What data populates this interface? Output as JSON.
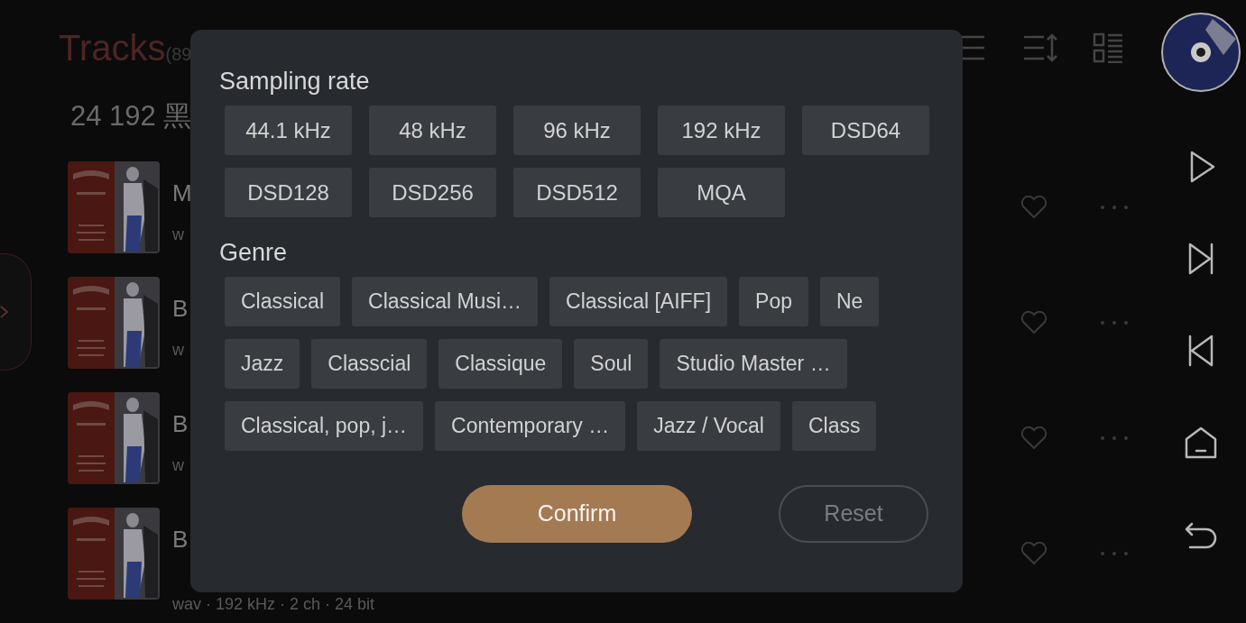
{
  "header": {
    "title": "Tracks",
    "count": "(89",
    "group": "24 192 黑"
  },
  "tracks": [
    {
      "title": "M",
      "subtitle": "w"
    },
    {
      "title": "B",
      "subtitle": "w"
    },
    {
      "title": "B",
      "subtitle": "w"
    },
    {
      "title": "B",
      "subtitle": "wav · 192 kHz · 2 ch · 24 bit"
    }
  ],
  "filter_dialog": {
    "sections": [
      {
        "heading": "Sampling rate",
        "kind": "grid",
        "rows": [
          [
            "44.1 kHz",
            "48 kHz",
            "96 kHz",
            "192 kHz",
            "DSD64"
          ],
          [
            "DSD128",
            "DSD256",
            "DSD512",
            "MQA"
          ]
        ]
      },
      {
        "heading": "Genre",
        "kind": "flow",
        "lines": [
          {
            "chips": [
              "Classical",
              "Classical Musi…",
              "Classical [AIFF]",
              "Pop",
              "Ne"
            ]
          },
          {
            "chips": [
              "Jazz",
              "Classcial",
              "Classique",
              "Soul",
              "Studio Master …"
            ]
          },
          {
            "chips": [
              "Classical, pop, j…",
              "Contemporary …",
              "Jazz / Vocal",
              "Class"
            ]
          }
        ]
      }
    ],
    "buttons": [
      {
        "label": "Confirm",
        "kind": "primary"
      },
      {
        "label": "Reset",
        "kind": "outline"
      }
    ]
  }
}
